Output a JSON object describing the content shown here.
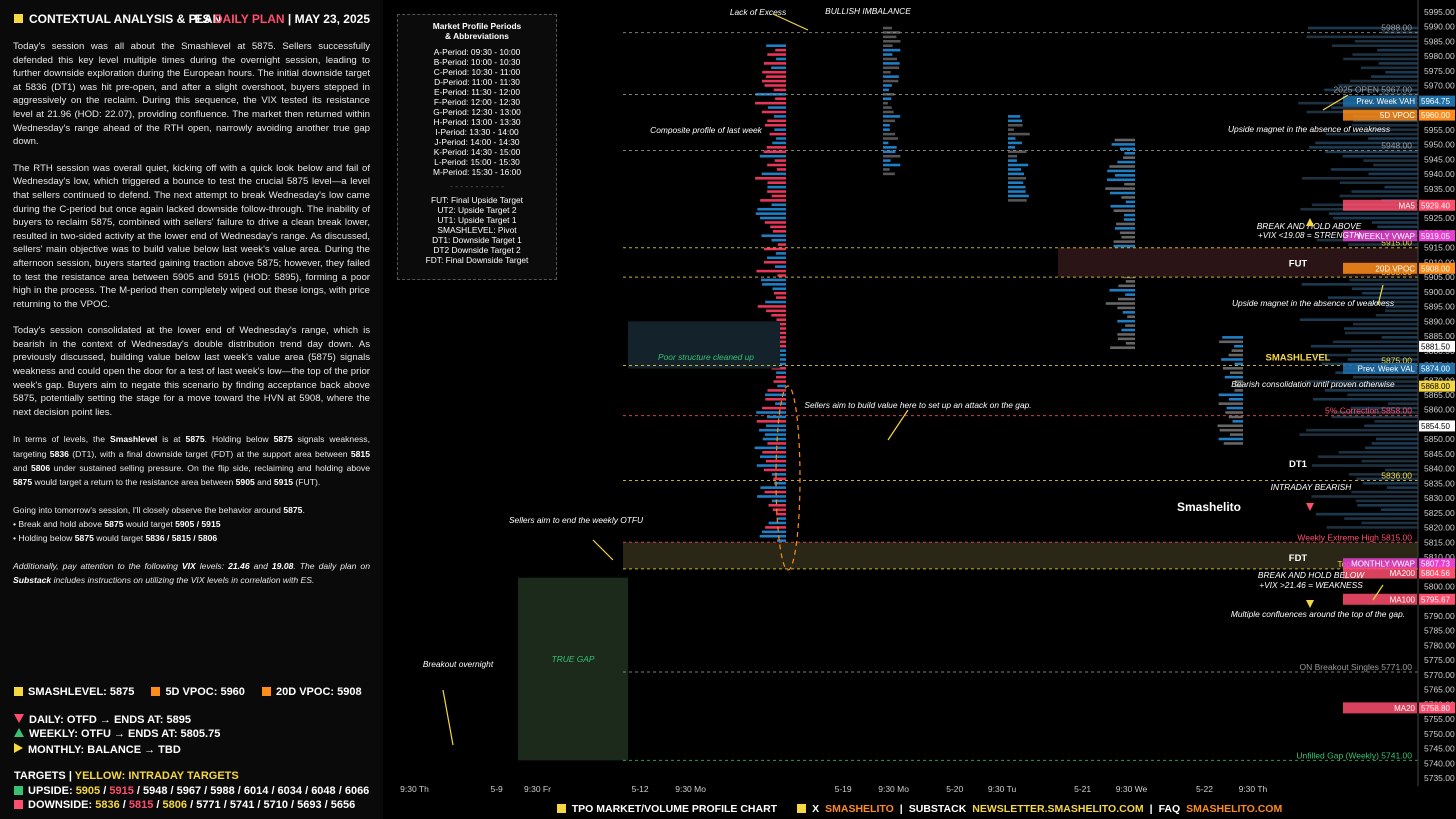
{
  "header": {
    "title": "CONTEXTUAL ANALYSIS & PLAN",
    "plan_prefix": "ES",
    "plan_label": "DAILY PLAN",
    "sep": "|",
    "date": "MAY 23, 2025"
  },
  "paragraphs": [
    "Today's session was all about the Smashlevel at 5875. Sellers successfully defended this key level multiple times during the overnight session, leading to further downside exploration during the European hours. The initial downside target at 5836 (DT1) was hit pre-open, and after a slight overshoot, buyers stepped in aggressively on the reclaim. During this sequence, the VIX tested its resistance level at 21.96 (HOD: 22.07), providing confluence. The market then returned within Wednesday's range ahead of the RTH open, narrowly avoiding another true gap down.",
    "The RTH session was overall quiet, kicking off with a quick look below and fail of Wednesday's low, which triggered a bounce to test the crucial 5875 level—a level that sellers continued to defend. The next attempt to break Wednesday's low came during the C-period but once again lacked downside follow-through. The inability of buyers to reclaim 5875, combined with sellers' failure to drive a clean break lower, resulted in two-sided activity at the lower end of Wednesday's range. As discussed, sellers' main objective was to build value below last week's value area. During the afternoon session, buyers started gaining traction above 5875; however, they failed to test the resistance area between 5905 and 5915 (HOD: 5895), forming a poor high in the process. The M-period then completely wiped out these longs, with price returning to the VPOC.",
    "Today's session consolidated at the lower end of Wednesday's range, which is bearish in the context of Wednesday's double distribution trend day down. As previously discussed, building value below last week's value area (5875) signals weakness and could open the door for a test of last week's low—the top of the prior week's gap. Buyers aim to negate this scenario by finding acceptance back above 5875, potentially setting the stage for a move toward the HVN at 5908, where the next decision point lies."
  ],
  "levels_paragraph": {
    "t1": "In terms of levels, the ",
    "b1": "Smashlevel",
    "t2": " is at ",
    "b2": "5875",
    "t3": ". Holding below ",
    "b3": "5875",
    "t4": " signals weakness, targeting ",
    "b4": "5836",
    "t5": " (DT1), with a final downside target (FDT) at the support area between ",
    "b5": "5815",
    "t6": " and ",
    "b6": "5806",
    "t7": " under sustained selling pressure. On the flip side, reclaiming and holding above ",
    "b7": "5875",
    "t8": " would target a return to the resistance area between ",
    "b8": "5905",
    "t9": " and ",
    "b9": "5915",
    "t10": " (FUT)."
  },
  "tomorrow": {
    "intro": "Going into tomorrow's session, I'll closely observe the behavior around ",
    "intro_level": "5875",
    "intro_end": ".",
    "bullet1_pre": "• Break and hold above ",
    "bullet1_level": "5875",
    "bullet1_mid": " would target ",
    "bullet1_targets": "5905 / 5915",
    "bullet2_pre": "• Holding below ",
    "bullet2_level": "5875",
    "bullet2_mid": " would target ",
    "bullet2_targets": "5836 / 5815 / 5806"
  },
  "vix_note": {
    "t1": "Additionally, pay attention to the following ",
    "b1": "VIX",
    "t2": " levels: ",
    "b2": "21.46",
    "t3": " and ",
    "b3": "19.08",
    "t4": ". The daily plan on ",
    "b4": "Substack",
    "t5": " includes instructions on utilizing the VIX levels in correlation with ES."
  },
  "legend": {
    "smashlevel": "SMASHLEVEL: 5875",
    "vpoc5": "5D VPOC: 5960",
    "vpoc20": "20D VPOC: 5908",
    "daily": "DAILY: OTFD → ENDS AT: 5895",
    "weekly": "WEEKLY: OTFU → ENDS AT: 5805.75",
    "monthly": "MONTHLY: BALANCE → TBD",
    "targets_label": "TARGETS",
    "targets_sep": "|",
    "targets_yellow": "YELLOW: INTRADAY TARGETS",
    "upside_label": "UPSIDE:",
    "upside_y1": "5905",
    "upside_s1": " / ",
    "upside_r1": "5915",
    "upside_rest": " / 5948 / 5967 / 5988 / 6014 / 6034 / 6048 / 6066",
    "downside_label": "DOWNSIDE:",
    "downside_y1": "5836",
    "downside_s1": " / ",
    "downside_r1": "5815",
    "downside_s2": " / ",
    "downside_y2": "5806",
    "downside_rest": " / 5771 / 5741 / 5710 / 5693 / 5656",
    "colors": {
      "yellow": "#f5d742",
      "orange": "#ff8c1a",
      "red": "#ff4d6d",
      "green": "#38c172"
    }
  },
  "periods_box": {
    "title": "Market Profile Periods",
    "subtitle": "& Abbreviations",
    "periods": [
      "A-Period: 09:30 - 10:00",
      "B-Period: 10:00 - 10:30",
      "C-Period: 10:30 - 11:00",
      "D-Period: 11:00 - 11:30",
      "E-Period: 11:30 - 12:00",
      "F-Period: 12:00 - 12:30",
      "G-Period: 12:30 - 13:00",
      "H-Period: 13:00 - 13:30",
      "I-Period: 13:30 - 14:00",
      "J-Period: 14:00 - 14:30",
      "K-Period: 14:30 - 15:00",
      "L-Period: 15:00 - 15:30",
      "M-Period: 15:30 - 16:00"
    ],
    "divider": "- - - - - - - - - - -",
    "abbreviations": [
      "FUT: Final Upside Target",
      "UT2: Upside Target 2",
      "UT1: Upside Target 1",
      "SMASHLEVEL: Pivot",
      "DT1: Downside Target 1",
      "DT2 Downside Target 2",
      "FDT: Final Downside Target"
    ]
  },
  "chart_data": {
    "type": "table",
    "ylim": [
      5735,
      5995
    ],
    "y_ticks": [
      5995,
      5990,
      5985,
      5980,
      5975,
      5970,
      5965,
      5960,
      5955,
      5950,
      5945,
      5940,
      5935,
      5930,
      5925,
      5920,
      5915,
      5910,
      5905,
      5900,
      5895,
      5890,
      5885,
      5880,
      5875,
      5870,
      5865,
      5860,
      5855,
      5850,
      5845,
      5840,
      5835,
      5830,
      5825,
      5820,
      5815,
      5810,
      5805,
      5800,
      5795,
      5790,
      5785,
      5780,
      5775,
      5770,
      5765,
      5760,
      5755,
      5750,
      5745,
      5740,
      5735
    ],
    "x_labels": [
      {
        "label": "9:30 Th",
        "pos": 0.012
      },
      {
        "label": "5-9",
        "pos": 0.101
      },
      {
        "label": "9:30 Fr",
        "pos": 0.134
      },
      {
        "label": "5-12",
        "pos": 0.24
      },
      {
        "label": "9:30 Mo",
        "pos": 0.283
      },
      {
        "label": "5-19",
        "pos": 0.44
      },
      {
        "label": "9:30 Mo",
        "pos": 0.483
      },
      {
        "label": "5-20",
        "pos": 0.55
      },
      {
        "label": "9:30 Tu",
        "pos": 0.591
      },
      {
        "label": "5-21",
        "pos": 0.676
      },
      {
        "label": "9:30 We",
        "pos": 0.717
      },
      {
        "label": "5-22",
        "pos": 0.796
      },
      {
        "label": "9:30 Th",
        "pos": 0.838
      }
    ],
    "reference_lines": [
      {
        "label": "5988.00",
        "price": 5988,
        "color": "#9a9a9a",
        "style": "dashed"
      },
      {
        "label": "2025 OPEN  5967.00",
        "price": 5967,
        "color": "#9a9a9a",
        "style": "dashed"
      },
      {
        "label": "5948.00",
        "price": 5948,
        "color": "#9a9a9a",
        "style": "dashed"
      },
      {
        "label": "5915.00",
        "price": 5915,
        "color": "#f5d742",
        "style": "dashed"
      },
      {
        "label": "5905.00",
        "price": 5905,
        "color": "#f5d742",
        "style": "dashed"
      },
      {
        "label": "5875.00",
        "price": 5875,
        "color": "#f5d742",
        "style": "dashed"
      },
      {
        "label": "5% Correction  5858.00",
        "price": 5858,
        "color": "#ff4d6d",
        "style": "dashed"
      },
      {
        "label": "5836.00",
        "price": 5836,
        "color": "#f5d742",
        "style": "dashed"
      },
      {
        "label": "Weekly Extreme High  5815.00",
        "price": 5815,
        "color": "#ff4d6d",
        "style": "dashed"
      },
      {
        "label": "Top of Gap  5806.00",
        "price": 5806,
        "color": "#f5d742",
        "style": "dashed"
      },
      {
        "label": "ON Breakout Singles  5771.00",
        "price": 5771,
        "color": "#9a9a9a",
        "style": "dashed"
      },
      {
        "label": "Unfilled Gap (Weekly)  5741.00",
        "price": 5741,
        "color": "#38c172",
        "style": "dashed"
      }
    ],
    "axis_badges": [
      {
        "label": "5964.75",
        "price": 5964.75,
        "color": "#1f6fa8",
        "tag": "Prev. Week VAH"
      },
      {
        "label": "5960.00",
        "price": 5960,
        "color": "#ff8c1a",
        "tag": "5D VPOC"
      },
      {
        "label": "5929.40",
        "price": 5929.4,
        "color": "#ff4d6d",
        "tag": "MA5"
      },
      {
        "label": "5919.05",
        "price": 5919.05,
        "color": "#e83fd0",
        "tag": "WEEKLY VWAP"
      },
      {
        "label": "5908.00",
        "price": 5908,
        "color": "#ff8c1a",
        "tag": "20D VPOC"
      },
      {
        "label": "5881.50",
        "price": 5881.5,
        "color": "#ffffff",
        "tag": ""
      },
      {
        "label": "5874.00",
        "price": 5874,
        "color": "#1f6fa8",
        "tag": "Prev. Week VAL"
      },
      {
        "label": "5868.00",
        "price": 5868,
        "color": "#f5d742",
        "tag": ""
      },
      {
        "label": "5854.50",
        "price": 5854.5,
        "color": "#ffffff",
        "tag": ""
      },
      {
        "label": "5807.73",
        "price": 5807.73,
        "color": "#e83fd0",
        "tag": "MONTHLY VWAP"
      },
      {
        "label": "5804.56",
        "price": 5804.56,
        "color": "#ff4d6d",
        "tag": "MA200"
      },
      {
        "label": "5795.67",
        "price": 5795.67,
        "color": "#ff4d6d",
        "tag": "MA100"
      },
      {
        "label": "5758.80",
        "price": 5758.8,
        "color": "#ff4d6d",
        "tag": "MA20"
      }
    ],
    "zone_labels": [
      {
        "label": "FUT",
        "price": 5910
      },
      {
        "label": "SMASHLEVEL",
        "price": 5878
      },
      {
        "label": "DT1",
        "price": 5842
      },
      {
        "label": "FDT",
        "price": 5810
      }
    ],
    "annotations": [
      "Lack of Excess",
      "BULLISH IMBALANCE",
      "Composite profile of last week",
      "Poor structure cleaned up",
      "Sellers aim to build value here to set up an attack on the gap.",
      "Sellers aim to end the weekly OTFU",
      "TRUE GAP",
      "Breakout overnight",
      "Upside magnet in the absence of weakness",
      "BREAK AND HOLD ABOVE",
      "+VIX <19.08 = STRENGTH",
      "Upside magnet in the absence of weakness",
      "Bearish consolidation until proven otherwise",
      "INTRADAY BEARISH",
      "BREAK AND HOLD BELOW",
      "+VIX >21.46 = WEAKNESS",
      "Multiple confluences around the top of the gap.",
      "Smashelito"
    ]
  },
  "footer": {
    "label1": "TPO MARKET/VOLUME PROFILE CHART",
    "x_label": "X",
    "x_handle": "SMASHELITO",
    "sep1": "|",
    "substack_label": "SUBSTACK",
    "substack_url": "NEWSLETTER.SMASHELITO.COM",
    "sep2": "|",
    "faq_label": "FAQ",
    "faq_url": "SMASHELITO.COM"
  }
}
